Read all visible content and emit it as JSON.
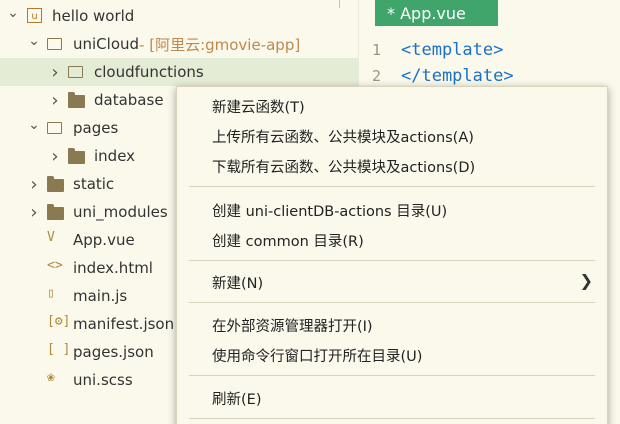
{
  "tree": [
    {
      "label": "hello world",
      "chevron": "down",
      "icon": "project",
      "indent": 0,
      "suffix": ""
    },
    {
      "label": "uniCloud",
      "chevron": "down",
      "icon": "folder-open",
      "indent": 1,
      "suffix": " - [阿里云:gmovie-app]"
    },
    {
      "label": "cloudfunctions",
      "chevron": "right",
      "icon": "folder-open",
      "indent": 2,
      "suffix": "",
      "selected": true
    },
    {
      "label": "database",
      "chevron": "right",
      "icon": "folder",
      "indent": 2,
      "suffix": ""
    },
    {
      "label": "pages",
      "chevron": "down",
      "icon": "folder-open",
      "indent": 1,
      "suffix": ""
    },
    {
      "label": "index",
      "chevron": "right",
      "icon": "folder",
      "indent": 2,
      "suffix": ""
    },
    {
      "label": "static",
      "chevron": "right",
      "icon": "folder",
      "indent": 1,
      "suffix": ""
    },
    {
      "label": "uni_modules",
      "chevron": "right",
      "icon": "folder",
      "indent": 1,
      "suffix": ""
    },
    {
      "label": "App.vue",
      "chevron": "",
      "icon": "vue-file",
      "indent": 1,
      "suffix": ""
    },
    {
      "label": "index.html",
      "chevron": "",
      "icon": "html-file",
      "indent": 1,
      "suffix": ""
    },
    {
      "label": "main.js",
      "chevron": "",
      "icon": "js-file",
      "indent": 1,
      "suffix": ""
    },
    {
      "label": "manifest.json",
      "chevron": "",
      "icon": "manifest-file",
      "indent": 1,
      "suffix": ""
    },
    {
      "label": "pages.json",
      "chevron": "",
      "icon": "json-file",
      "indent": 1,
      "suffix": ""
    },
    {
      "label": "uni.scss",
      "chevron": "",
      "icon": "scss-file",
      "indent": 1,
      "suffix": ""
    }
  ],
  "editor": {
    "tab_label": "* App.vue",
    "lines": [
      {
        "num": "1",
        "code": "<template>"
      },
      {
        "num": "2",
        "code": "</template>"
      }
    ]
  },
  "menu": {
    "items": [
      "新建云函数(T)",
      "上传所有云函数、公共模块及actions(A)",
      "下载所有云函数、公共模块及actions(D)",
      "创建 uni-clientDB-actions 目录(U)",
      "创建 common 目录(R)",
      "新建(N)",
      "在外部资源管理器打开(I)",
      "使用命令行窗口打开所在目录(U)",
      "刷新(E)"
    ]
  },
  "colors": {
    "background": "#fbf9ec",
    "tab": "#3fa56a",
    "selected_row": "#e4ecd6",
    "code_keyword": "#1a70c8"
  }
}
